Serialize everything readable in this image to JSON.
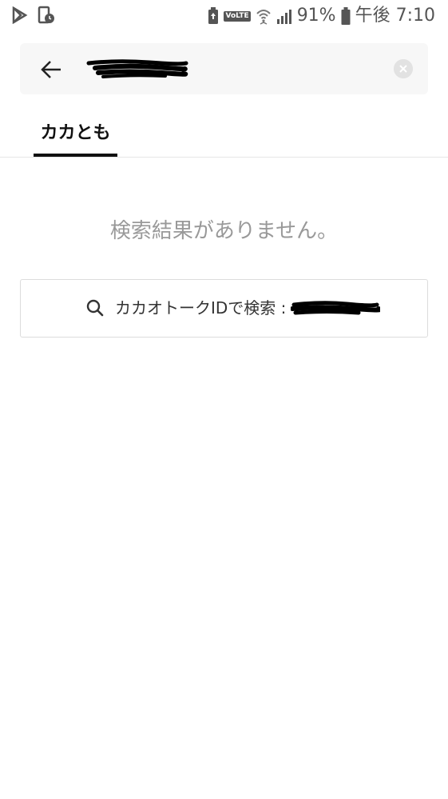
{
  "status_bar": {
    "icons_left": [
      "play-store-notification-icon",
      "screen-record-icon"
    ],
    "icons_right": [
      "battery-saver-icon",
      "volte-icon",
      "wifi-icon",
      "signal-icon",
      "battery-icon"
    ],
    "volte_label": "VoLTE",
    "battery_percent": "91%",
    "time": "午後 7:10"
  },
  "search": {
    "query_redacted": true,
    "back_icon": "back-arrow-icon",
    "clear_icon": "clear-icon"
  },
  "tabs": [
    {
      "label": "カカとも",
      "active": true
    }
  ],
  "results": {
    "empty_message": "検索結果がありません。"
  },
  "id_search": {
    "icon": "search-icon",
    "label": "カカオトークIDで検索 :",
    "id_redacted": true
  },
  "colors": {
    "accent": "#111111",
    "muted_text": "#999999",
    "search_bg": "#f7f7f7",
    "border": "#dcdcdc"
  }
}
